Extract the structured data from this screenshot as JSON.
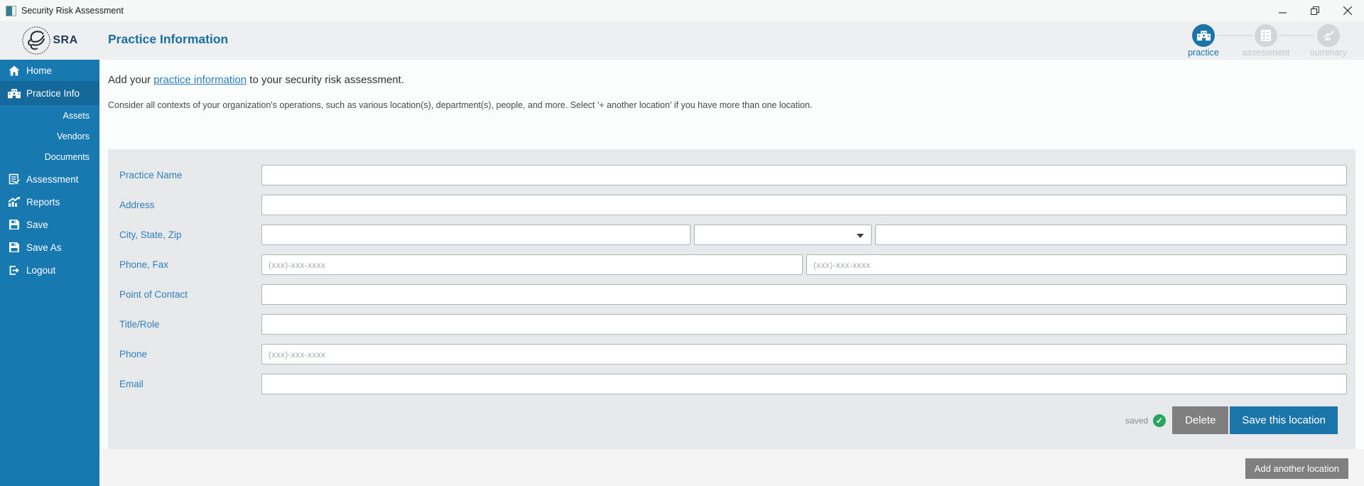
{
  "window": {
    "title": "Security Risk Assessment"
  },
  "logo": {
    "abbr": "SRA"
  },
  "header": {
    "title": "Practice Information",
    "steps": [
      {
        "label": "practice",
        "state": "active"
      },
      {
        "label": "assessment",
        "state": "inactive"
      },
      {
        "label": "summary",
        "state": "inactive"
      }
    ]
  },
  "sidebar": {
    "items": [
      {
        "label": "Home"
      },
      {
        "label": "Practice Info",
        "selected": true
      },
      {
        "label": "Assets"
      },
      {
        "label": "Vendors"
      },
      {
        "label": "Documents"
      },
      {
        "label": "Assessment"
      },
      {
        "label": "Reports"
      },
      {
        "label": "Save"
      },
      {
        "label": "Save As"
      },
      {
        "label": "Logout"
      }
    ]
  },
  "intro": {
    "prefix": "Add your ",
    "link": "practice information",
    "suffix": " to your security risk assessment.",
    "note": "Consider all contexts of your organization's operations, such as various location(s), department(s), people, and more. Select '+ another location' if you have more than one location."
  },
  "form": {
    "labels": {
      "practice_name": "Practice Name",
      "address": "Address",
      "city_state_zip": "City, State, Zip",
      "phone_fax": "Phone, Fax",
      "point_of_contact": "Point of Contact",
      "title_role": "Title/Role",
      "phone": "Phone",
      "email": "Email"
    },
    "placeholders": {
      "phone": "(xxx)-xxx-xxxx",
      "fax": "(xxx)-xxx-xxxx",
      "contact_phone": "(xxx)-xxx-xxxx"
    },
    "values": {
      "practice_name": "",
      "address": "",
      "city": "",
      "state": "",
      "zip": "",
      "phone": "",
      "fax": "",
      "point_of_contact": "",
      "title_role": "",
      "contact_phone": "",
      "email": ""
    }
  },
  "footer": {
    "saved": "saved",
    "check": "✓",
    "delete": "Delete",
    "save_location": "Save this location",
    "add_location": "Add another location"
  },
  "colors": {
    "sidebar_blue": "#1878b0",
    "sidebar_selected_blue": "#14689a",
    "accent_blue": "#1b75a9",
    "heading_blue": "#1a6fa2",
    "label_blue": "#2e80bd",
    "link_blue": "#2d7fc1",
    "saved_green": "#28a661",
    "button_gray": "#7f7f7f",
    "panel_gray": "#e8e9ea",
    "inactive_step_gray": "#d3d6d8"
  }
}
